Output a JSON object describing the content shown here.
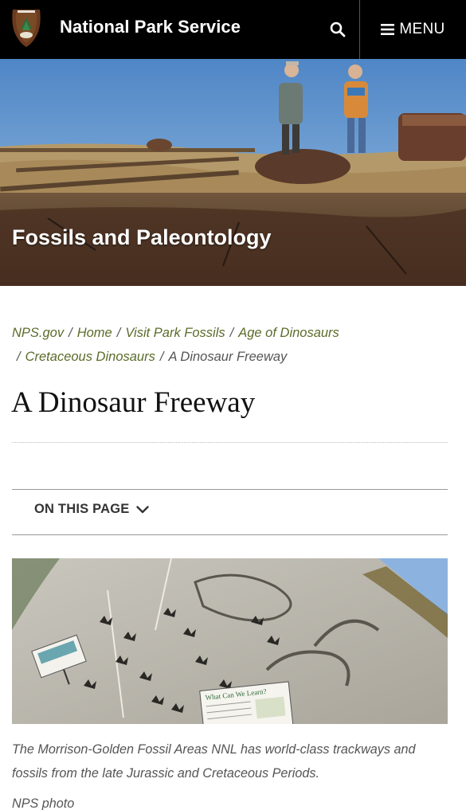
{
  "header": {
    "site_title": "National Park Service",
    "menu_label": "MENU",
    "logo_icon": "nps-arrowhead-logo",
    "search_icon": "search-icon",
    "menu_icon": "hamburger-icon",
    "background": "#000000"
  },
  "hero": {
    "title": "Fossils and Paleontology"
  },
  "breadcrumb": {
    "items": [
      "NPS.gov",
      "Home",
      "Visit Park Fossils",
      "Age of Dinosaurs",
      "Cretaceous Dinosaurs"
    ],
    "current": "A Dinosaur Freeway",
    "separator": "/",
    "link_color": "#5a6c2a"
  },
  "page": {
    "title": "A Dinosaur Freeway"
  },
  "on_this_page": {
    "label": "ON THIS PAGE"
  },
  "feature": {
    "sign_text": "What Can We Learn?",
    "caption": "The Morrison-Golden Fossil Areas NNL has world-class trackways and fossils from the late Jurassic and Cretaceous Periods.",
    "credit": "NPS photo"
  }
}
